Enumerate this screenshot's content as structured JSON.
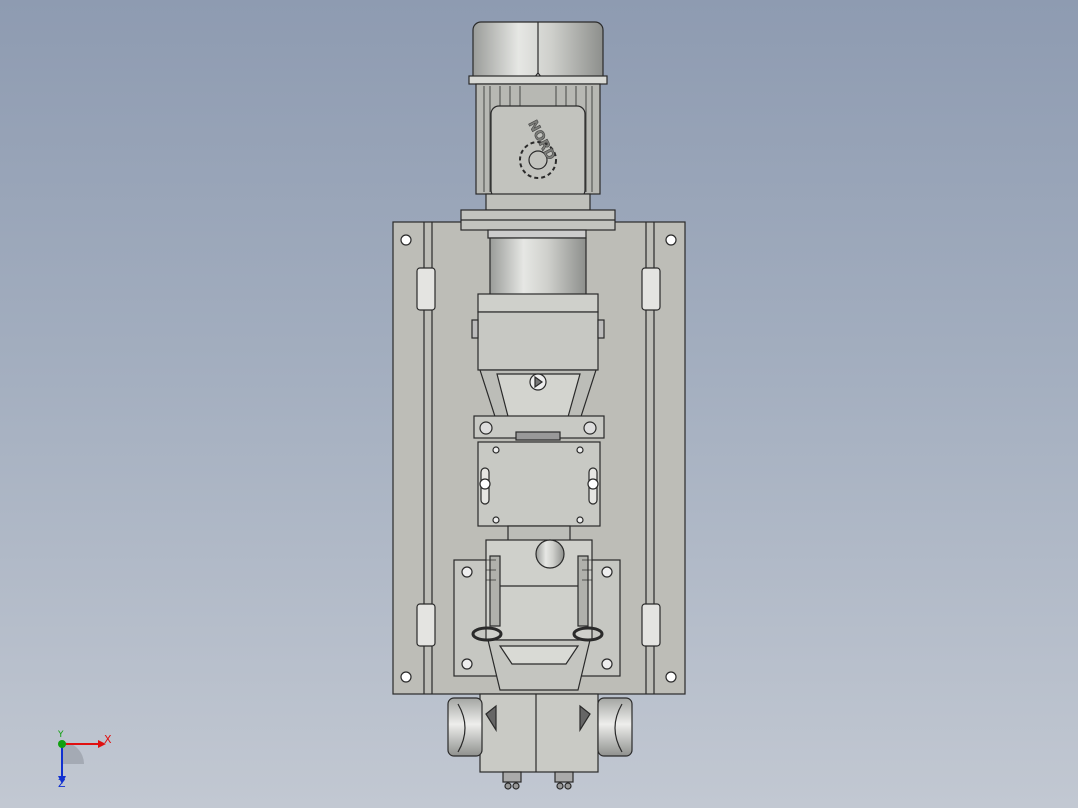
{
  "viewport": {
    "background_top": "#8e9bb1",
    "background_bottom": "#c2c8d2"
  },
  "model": {
    "motor_brand": "NORD",
    "body_color": "#c9cac6",
    "plate_color": "#bdbdb7",
    "outline_color": "#2a2a2a"
  },
  "triad": {
    "x_label": "X",
    "y_label": "Y",
    "z_label": "Z",
    "x_color": "#e01010",
    "y_color": "#10a010",
    "z_color": "#1030d0"
  }
}
